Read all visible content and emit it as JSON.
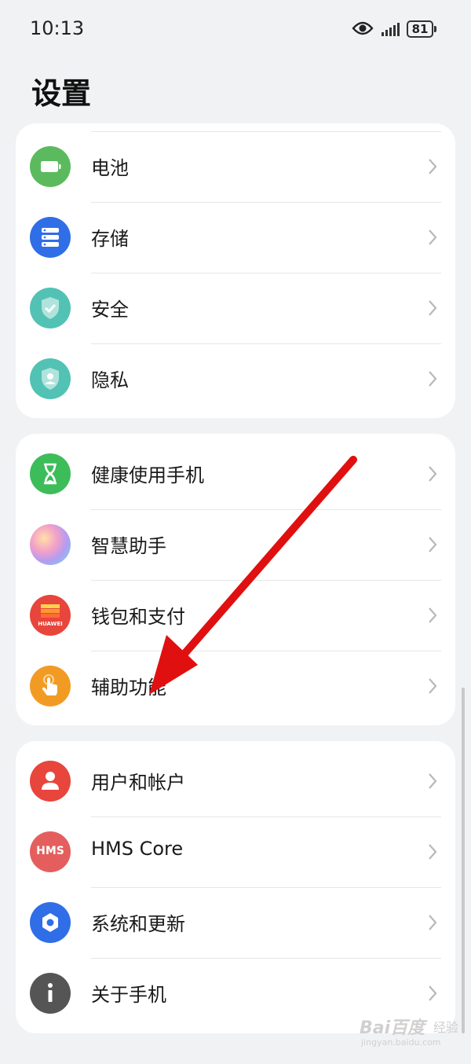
{
  "status_bar": {
    "time": "10:13",
    "battery": "81"
  },
  "page": {
    "title": "设置"
  },
  "groups": [
    {
      "items": [
        {
          "label": "电池",
          "icon": "battery-icon",
          "color": "#5cba5e"
        },
        {
          "label": "存储",
          "icon": "storage-icon",
          "color": "#2f6ee6"
        },
        {
          "label": "安全",
          "icon": "security-shield-icon",
          "color": "#52c2b4"
        },
        {
          "label": "隐私",
          "icon": "privacy-shield-icon",
          "color": "#52c2b4"
        }
      ]
    },
    {
      "items": [
        {
          "label": "健康使用手机",
          "icon": "hourglass-icon",
          "color": "#3dbd5a"
        },
        {
          "label": "智慧助手",
          "icon": "assistant-orb-icon",
          "color": "#c9a6ee"
        },
        {
          "label": "钱包和支付",
          "icon": "wallet-icon",
          "color": "#e8453c"
        },
        {
          "label": "辅助功能",
          "icon": "hand-touch-icon",
          "color": "#f29b24"
        }
      ]
    },
    {
      "items": [
        {
          "label": "用户和帐户",
          "icon": "user-icon",
          "color": "#e8453c"
        },
        {
          "label": "HMS Core",
          "icon": "hms-core-icon",
          "color": "#e55e5e"
        },
        {
          "label": "系统和更新",
          "icon": "system-gear-icon",
          "color": "#2f6ee6"
        },
        {
          "label": "关于手机",
          "icon": "info-icon",
          "color": "#555555"
        }
      ]
    }
  ],
  "icon_text": {
    "wallet_brand": "HUAWEI",
    "hms": "HMS"
  },
  "annotation": {
    "arrow_color": "#e01010",
    "points_to": "辅助功能"
  },
  "watermark": {
    "logo": "Bai百度",
    "subtitle": "经验",
    "url": "jingyan.baidu.com"
  }
}
